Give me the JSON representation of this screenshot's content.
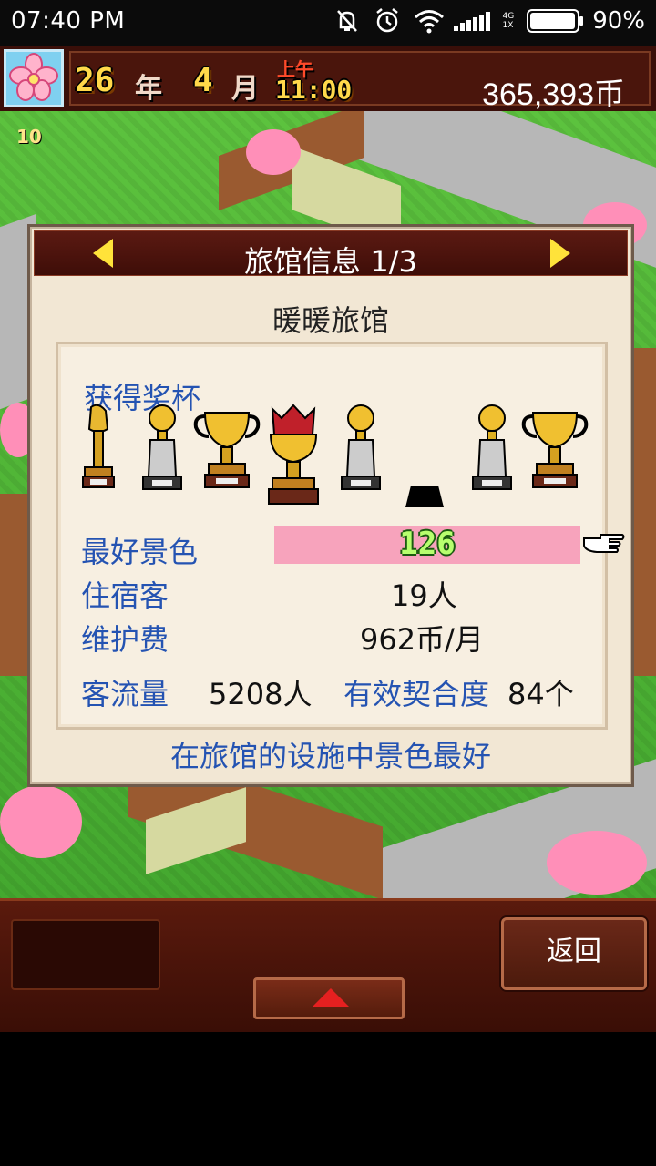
{
  "status_bar": {
    "time": "07:40  PM",
    "network_label": "4G\n1X",
    "battery_percent": "90%",
    "battery_level": 0.9
  },
  "hud": {
    "year_value": "26",
    "year_unit": "年",
    "month_value": "4",
    "month_unit": "月",
    "period": "上午",
    "clock": "11:00",
    "money": "365,393币"
  },
  "map": {
    "level_badge": "10"
  },
  "dialog": {
    "title": "旅馆信息 1/3",
    "inn_name": "暖暖旅馆",
    "trophies_label": "获得奖杯",
    "trophies": [
      {
        "icon": "torch-trophy-icon",
        "state": "earned"
      },
      {
        "icon": "bell-trophy-icon",
        "state": "earned"
      },
      {
        "icon": "cup-trophy-icon",
        "state": "earned"
      },
      {
        "icon": "crown-trophy-icon",
        "state": "earned"
      },
      {
        "icon": "bell-trophy-icon",
        "state": "earned"
      },
      {
        "icon": "trophy-silhouette-icon",
        "state": "locked"
      },
      {
        "icon": "bell-trophy-icon",
        "state": "earned"
      },
      {
        "icon": "cup-trophy-icon",
        "state": "earned"
      }
    ],
    "rows": {
      "best_scenery_label": "最好景色",
      "best_scenery_value": "126",
      "guests_label": "住宿客",
      "guests_value": "19人",
      "maintenance_label": "维护费",
      "maintenance_value": "962币/月",
      "traffic_label": "客流量",
      "traffic_value": "5208人",
      "match_label": "有效契合度",
      "match_value": "84个"
    },
    "footer_note": "在旅馆的设施中景色最好"
  },
  "bottom_bar": {
    "back_label": "返回"
  },
  "colors": {
    "hud_bg": "#3a0f09",
    "dialog_bg": "#f2e7d4",
    "label_blue": "#2453b2",
    "scenery_bar": "#f7a3bc",
    "gold": "#ffd94a"
  }
}
